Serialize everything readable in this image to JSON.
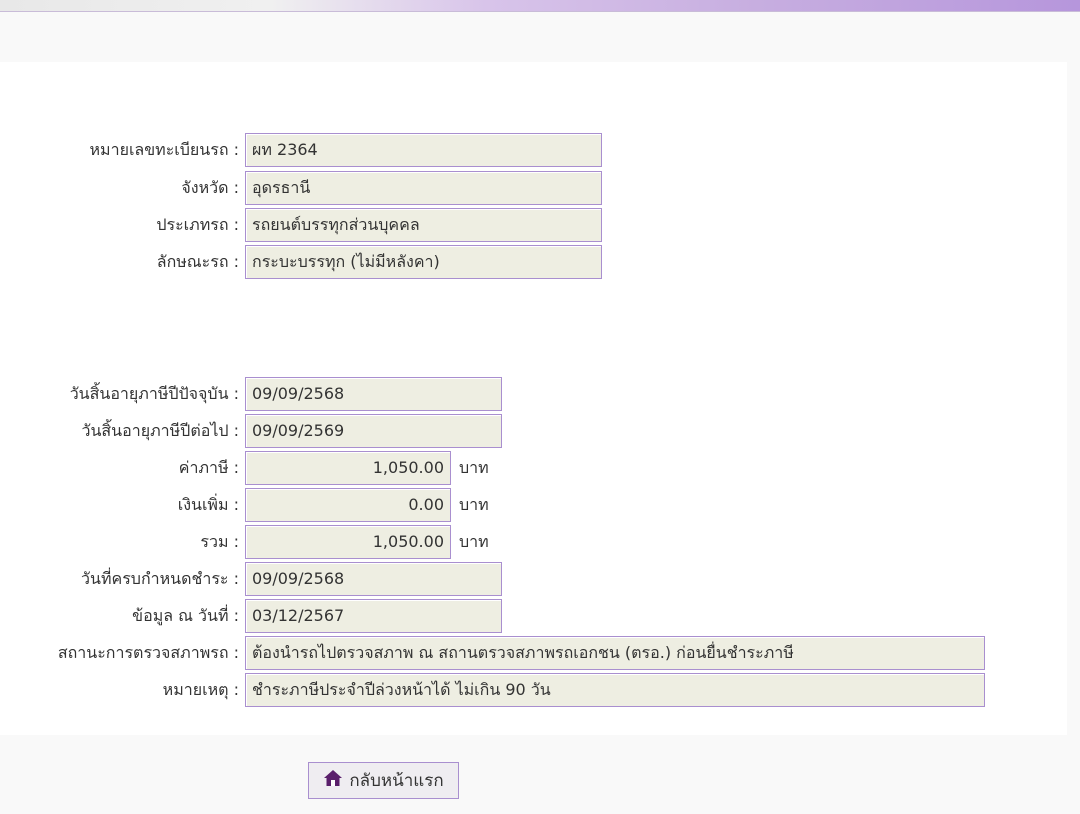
{
  "vehicle": [
    {
      "label": "หมายเลขทะเบียนรถ :",
      "value": "ผท 2364"
    },
    {
      "label": "จังหวัด :",
      "value": "อุดรธานี"
    },
    {
      "label": "ประเภทรถ :",
      "value": "รถยนต์บรรทุกส่วนบุคคล"
    },
    {
      "label": "ลักษณะรถ :",
      "value": "กระบะบรรทุก (ไม่มีหลังคา)"
    }
  ],
  "tax": {
    "current_expiry": {
      "label": "วันสิ้นอายุภาษีปีปัจจุบัน :",
      "value": "09/09/2568"
    },
    "next_expiry": {
      "label": "วันสิ้นอายุภาษีปีต่อไป :",
      "value": "09/09/2569"
    },
    "tax_amount": {
      "label": "ค่าภาษี :",
      "value": "1,050.00",
      "unit": "บาท"
    },
    "surcharge": {
      "label": "เงินเพิ่ม :",
      "value": "0.00",
      "unit": "บาท"
    },
    "total": {
      "label": "รวม :",
      "value": "1,050.00",
      "unit": "บาท"
    },
    "due_date": {
      "label": "วันที่ครบกำหนดชำระ :",
      "value": "09/09/2568"
    },
    "data_as_of": {
      "label": "ข้อมูล ณ วันที่ :",
      "value": "03/12/2567"
    },
    "inspection_status": {
      "label": "สถานะการตรวจสภาพรถ :",
      "value": "ต้องนำรถไปตรวจสภาพ ณ สถานตรวจสภาพรถเอกชน (ตรอ.) ก่อนยื่นชำระภาษี"
    },
    "remark": {
      "label": "หมายเหตุ :",
      "value": "ชำระภาษีประจำปีล่วงหน้าได้ ไม่เกิน 90 วัน"
    }
  },
  "home_button": {
    "label": "กลับหน้าแรก",
    "icon": "home-icon",
    "icon_color": "#5a1f6b"
  }
}
